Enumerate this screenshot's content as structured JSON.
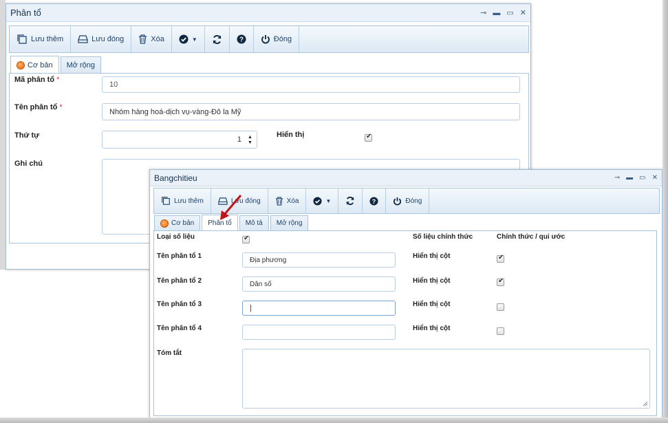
{
  "window1": {
    "title": "Phân tổ",
    "toolbar": [
      {
        "label": "Lưu thêm",
        "icon": "copy-icon"
      },
      {
        "label": "Lưu đóng",
        "icon": "drive-icon"
      },
      {
        "label": "Xóa",
        "icon": "trash-icon"
      },
      {
        "label": "",
        "icon": "check-circle-dropdown-icon"
      },
      {
        "label": "",
        "icon": "refresh-icon"
      },
      {
        "label": "",
        "icon": "help-icon"
      },
      {
        "label": "Đóng",
        "icon": "power-icon"
      }
    ],
    "tabs": [
      "Cơ bản",
      "Mở rộng"
    ],
    "form": {
      "ma_label": "Mã phân tổ",
      "ma_value": "10",
      "ten_label": "Tên phân tổ",
      "ten_value": "Nhóm hàng hoá-dịch vụ-vàng-Đô la Mỹ",
      "thutu_label": "Thứ tự",
      "thutu_value": "1",
      "hienthi_label": "Hiển thị",
      "hienthi_checked": true,
      "ghichu_label": "Ghi chú",
      "required_mark": "*"
    }
  },
  "window2": {
    "title": "Bangchitieu",
    "toolbar": [
      {
        "label": "Lưu thêm",
        "icon": "copy-icon"
      },
      {
        "label": "Lưu đóng",
        "icon": "drive-icon"
      },
      {
        "label": "Xóa",
        "icon": "trash-icon"
      },
      {
        "label": "",
        "icon": "check-circle-dropdown-icon"
      },
      {
        "label": "",
        "icon": "refresh-icon"
      },
      {
        "label": "",
        "icon": "help-icon"
      },
      {
        "label": "Đóng",
        "icon": "power-icon"
      }
    ],
    "tabs": [
      "Cơ bản",
      "Phân tổ",
      "Mô tả",
      "Mở rộng"
    ],
    "form": {
      "loai_label": "Loại số liệu",
      "loai_checked": true,
      "solieu_label": "Số liệu chính thức",
      "chinhthuc_label": "Chính thức / qui ước",
      "ten1_label": "Tên phân tổ 1",
      "ten1_value": "Địa phương",
      "ten2_label": "Tên phân tổ 2",
      "ten2_value": "Dân số",
      "ten3_label": "Tên phân tổ 3",
      "ten3_value": "|",
      "ten4_label": "Tên phân tổ 4",
      "ten4_value": "",
      "hienthi_label": "Hiển thị cột",
      "hienthi_checks": [
        true,
        true,
        false,
        false
      ],
      "tomtat_label": "Tóm tắt"
    }
  },
  "colors": {
    "accent": "#a7c4df",
    "arrow": "#c0141b"
  }
}
